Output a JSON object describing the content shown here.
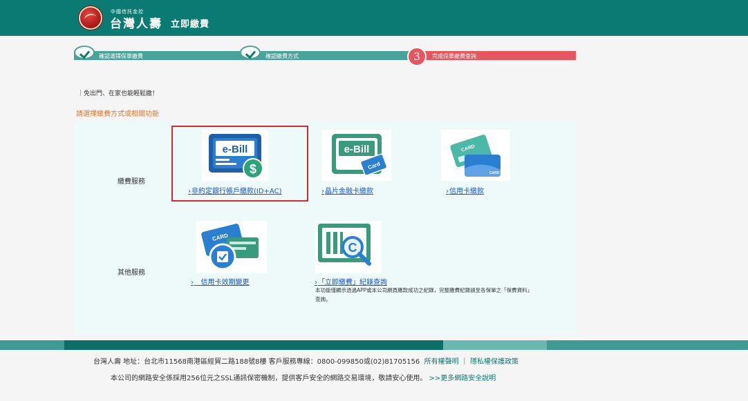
{
  "header": {
    "logo_sub": "中國信託金控",
    "logo_name": "台灣人壽",
    "app_title": "立即繳費"
  },
  "steps": [
    {
      "label": "確認選擇保單繳費",
      "state": "done"
    },
    {
      "label": "確認繳費方式",
      "state": "done"
    },
    {
      "label": "完成保單繳費查詢",
      "number": "3",
      "state": "current"
    }
  ],
  "intro": "｜免出門、在家也能輕鬆繳！",
  "choose_prompt": "請選擇繳費方式或相關功能",
  "sections": {
    "payment": {
      "label": "繳費服務",
      "items": [
        {
          "icon": "ebill-bank-account-icon",
          "link": "非約定銀行帳戶繳款(ID+AC)"
        },
        {
          "icon": "ebill-chip-card-icon",
          "link": "晶片金融卡繳款"
        },
        {
          "icon": "credit-card-icon",
          "link": "信用卡繳款"
        }
      ]
    },
    "other": {
      "label": "其他服務",
      "items": [
        {
          "icon": "credit-card-change-icon",
          "link": "信用卡效期變更"
        },
        {
          "icon": "payment-record-search-icon",
          "link": "「立即繳費」紀錄查詢",
          "note": "本功能僅顯示透過APP或本公司網頁繳款成功之紀錄，完整繳費紀錄請至各保單之「保費資料」查詢。"
        }
      ]
    }
  },
  "footer": {
    "line1": "台灣人壽  地址：台北市11568南港區經貿二路188號8樓  客戶服務專線：0800-099850或(02)81705156",
    "link_rights": "所有權聲明",
    "sep": "｜",
    "link_privacy": "隱私權保護政策",
    "line2": "本公司的網路安全係採用256位元之SSL通訊保密機制，提供客戶安全的網路交易環境，敬請安心使用。",
    "link_security": ">>更多網路安全說明"
  },
  "colors": {
    "header_teal": "#0b7a72",
    "step_done": "#4aa39a",
    "step_current": "#e5565f",
    "link_blue": "#1a55c8",
    "prompt_orange": "#e87722",
    "highlight_red": "#d9272e"
  }
}
